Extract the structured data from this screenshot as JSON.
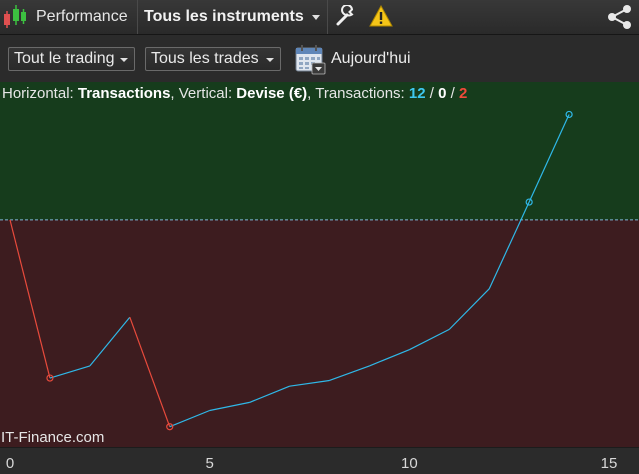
{
  "header": {
    "app_icon": "candlestick-chart-icon",
    "title": "Performance",
    "instrument_selector": "Tous les instruments",
    "settings_icon": "wrench-icon",
    "warning_icon": "warning-icon",
    "share_icon": "share-icon"
  },
  "toolbar": {
    "trading_filter": "Tout le trading",
    "trades_filter": "Tous les trades",
    "calendar_icon": "calendar-icon",
    "date_range": "Aujourd'hui"
  },
  "info": {
    "prefix": "Horizontal: ",
    "horizontal": "Transactions",
    "mid1": ", Vertical: ",
    "vertical": "Devise (€)",
    "mid2": ", Transactions: ",
    "count_win": "12",
    "slash1": " / ",
    "count_even": "0",
    "slash2": " / ",
    "count_loss": "2"
  },
  "watermark": "IT-Finance.com",
  "colors": {
    "profit_zone": "#163c1c",
    "loss_zone": "#3d1c1f",
    "line_up": "#2fb8e8",
    "line_down": "#e84a3c",
    "baseline": "#7fb8d8"
  },
  "chart_data": {
    "type": "line",
    "xlabel": "Transactions",
    "ylabel": "Devise (€)",
    "x_ticks": [
      "0",
      "5",
      "10",
      "15"
    ],
    "xlim": [
      0,
      15.4
    ],
    "ylim": [
      -28,
      17
    ],
    "baseline": 0,
    "points": [
      {
        "x": 0,
        "y": 0
      },
      {
        "x": 1,
        "y": -19.5
      },
      {
        "x": 2,
        "y": -18
      },
      {
        "x": 3,
        "y": -12
      },
      {
        "x": 4,
        "y": -25.5
      },
      {
        "x": 5,
        "y": -23.5
      },
      {
        "x": 6,
        "y": -22.5
      },
      {
        "x": 7,
        "y": -20.5
      },
      {
        "x": 8,
        "y": -19.8
      },
      {
        "x": 9,
        "y": -18
      },
      {
        "x": 10,
        "y": -16
      },
      {
        "x": 11,
        "y": -13.5
      },
      {
        "x": 12,
        "y": -8.5
      },
      {
        "x": 13,
        "y": 2.2
      },
      {
        "x": 14,
        "y": 13
      }
    ],
    "marked_points": [
      1,
      4,
      13,
      14
    ],
    "grid": false
  }
}
